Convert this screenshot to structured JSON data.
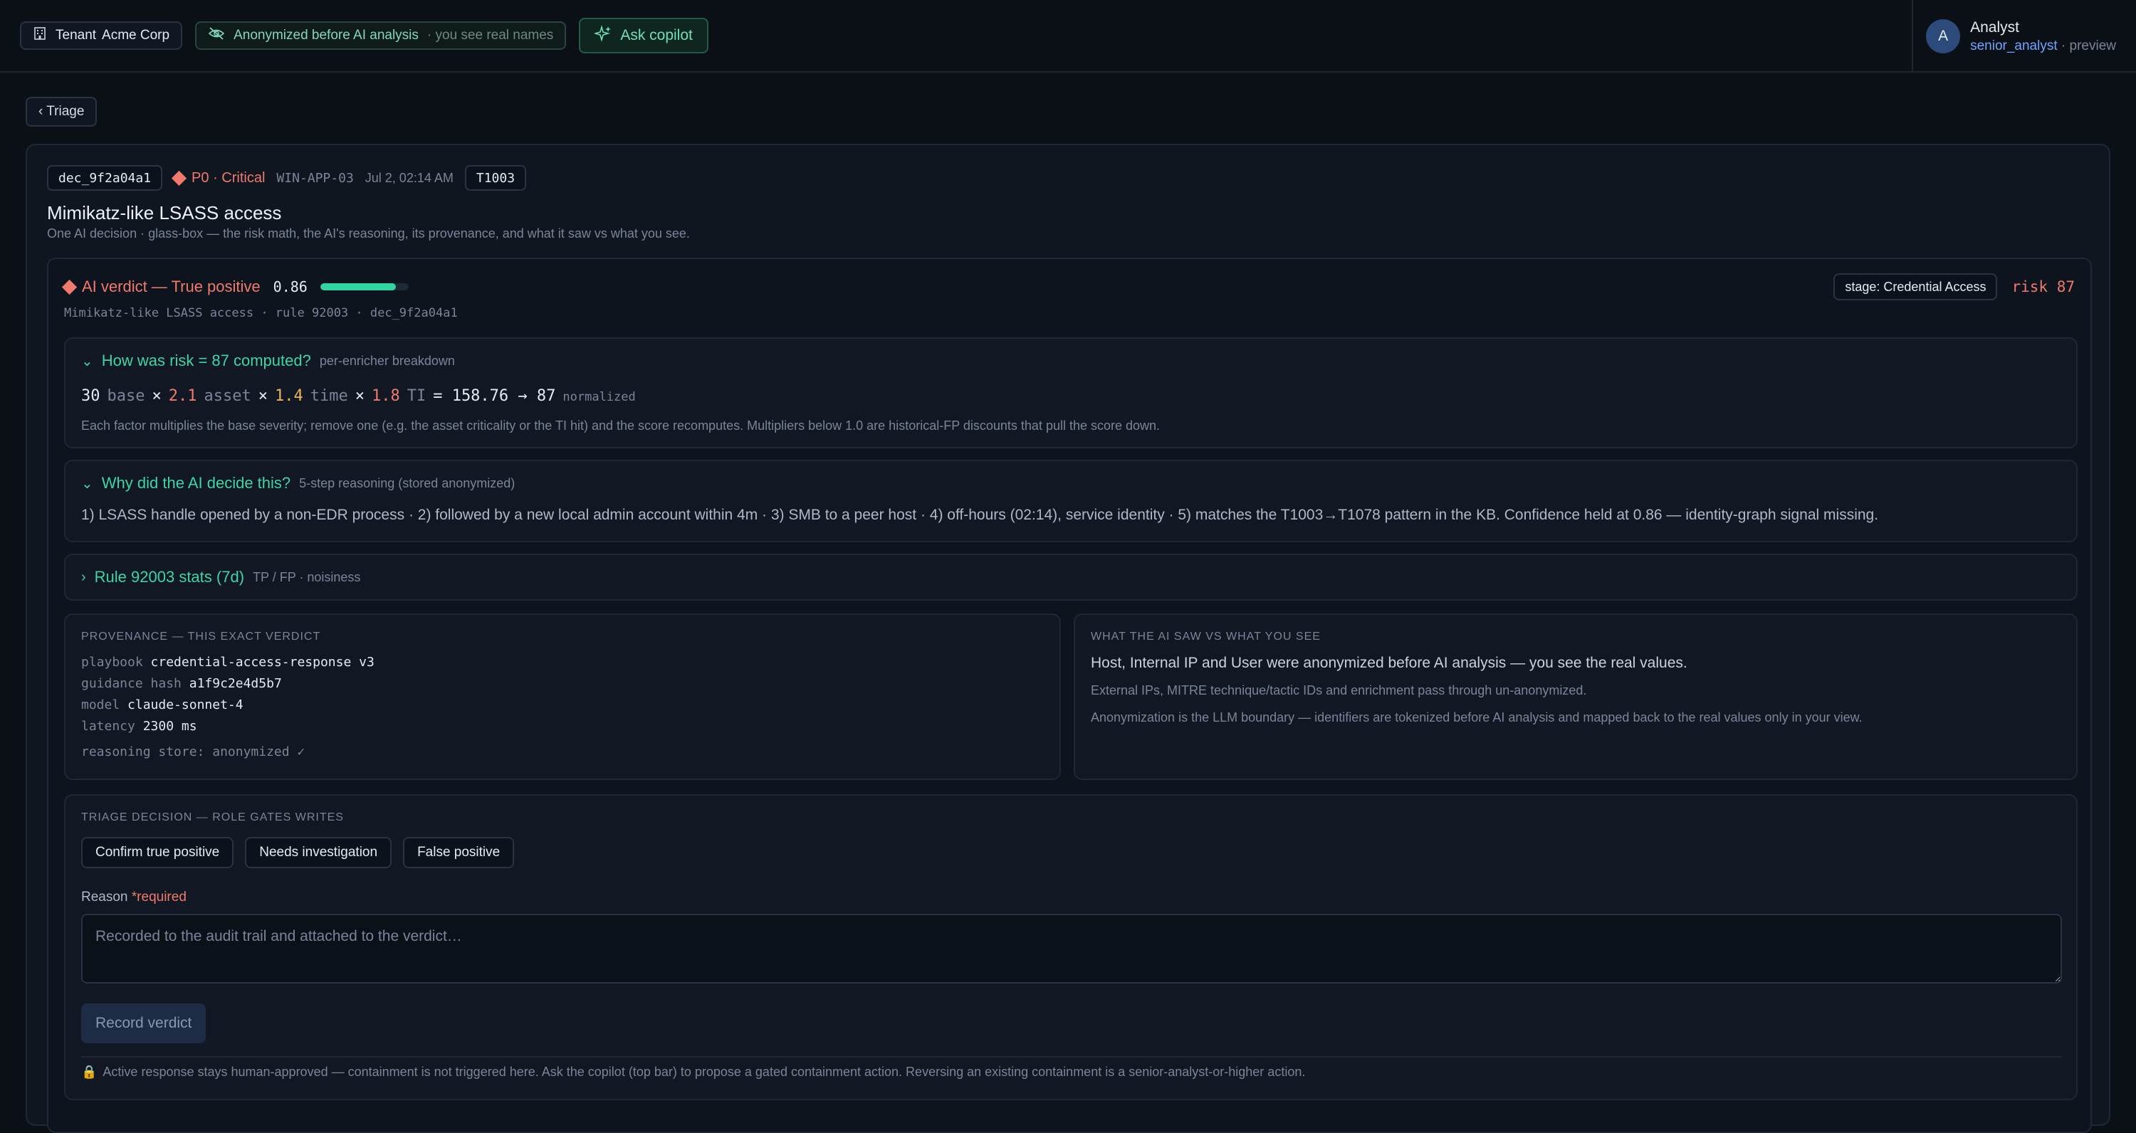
{
  "topbar": {
    "tenant_label": "Tenant",
    "tenant_name": "Acme Corp",
    "anon_label": "Anonymized before AI analysis",
    "anon_note": "· you see real names",
    "copilot_label": "Ask copilot"
  },
  "user": {
    "avatar_letter": "A",
    "name": "Analyst",
    "role": "senior_analyst",
    "mode": "· preview"
  },
  "nav": {
    "back_label": "‹ Triage"
  },
  "alert": {
    "id": "dec_9f2a04a1",
    "severity": "P0 · Critical",
    "host": "WIN-APP-03",
    "time": "Jul 2, 02:14 AM",
    "technique": "T1003",
    "title": "Mimikatz-like LSASS access",
    "subtitle": "One AI decision · glass-box — the risk math, the AI's reasoning, its provenance, and what it saw vs what you see."
  },
  "verdict": {
    "label": "AI verdict — True positive",
    "confidence": "0.86",
    "confidence_value": 0.86,
    "meta": "Mimikatz-like LSASS access · rule 92003 · dec_9f2a04a1",
    "stage": "stage: Credential Access",
    "risk": "risk 87"
  },
  "risk_breakdown": {
    "chevron": "⌄",
    "title": "How was risk = 87 computed?",
    "subtitle": "per-enricher breakdown",
    "base_val": "30",
    "base_lbl": "base",
    "times1": "×",
    "asset_val": "2.1",
    "asset_lbl": "asset",
    "times2": "×",
    "time_val": "1.4",
    "time_lbl": "time",
    "times3": "×",
    "ti_val": "1.8",
    "ti_lbl": "TI",
    "eq": "= 158.76 → 87",
    "norm": "normalized",
    "note": "Each factor multiplies the base severity; remove one (e.g. the asset criticality or the TI hit) and the score recomputes. Multipliers below 1.0 are historical-FP discounts that pull the score down."
  },
  "reasoning": {
    "chevron": "⌄",
    "title": "Why did the AI decide this?",
    "subtitle": "5-step reasoning (stored anonymized)",
    "text": "1) LSASS handle opened by a non-EDR process · 2) followed by a new local admin account within 4m · 3) SMB to a peer host · 4) off-hours (02:14), service identity · 5) matches the T1003→T1078 pattern in the KB. Confidence held at 0.86 — identity-graph signal missing."
  },
  "rule_stats": {
    "chevron": "›",
    "title": "Rule 92003 stats (7d)",
    "subtitle": "TP / FP · noisiness"
  },
  "provenance": {
    "caption": "PROVENANCE — THIS EXACT VERDICT",
    "playbook_k": "playbook",
    "playbook_v": "credential-access-response v3",
    "hash_k": "guidance hash",
    "hash_v": "a1f9c2e4d5b7",
    "model_k": "model",
    "model_v": "claude-sonnet-4",
    "latency_k": "latency",
    "latency_v": "2300 ms",
    "store": "reasoning store: anonymized ✓"
  },
  "saw": {
    "caption": "WHAT THE AI SAW VS WHAT YOU SEE",
    "main": "Host, Internal IP and User were anonymized before AI analysis — you see the real values.",
    "line1": "External IPs, MITRE technique/tactic IDs and enrichment pass through un-anonymized.",
    "line2": "Anonymization is the LLM boundary — identifiers are tokenized before AI analysis and mapped back to the real values only in your view."
  },
  "triage": {
    "caption": "TRIAGE DECISION — ROLE GATES WRITES",
    "btn_confirm": "Confirm true positive",
    "btn_investigate": "Needs investigation",
    "btn_fp": "False positive",
    "reason_label": "Reason",
    "reason_required": "*required",
    "reason_placeholder": "Recorded to the audit trail and attached to the verdict…",
    "record_label": "Record verdict",
    "lock": "🔒",
    "footer": "Active response stays human-approved — containment is not triggered here. Ask the copilot (top bar) to propose a gated containment action. Reversing an existing containment is a senior-analyst-or-higher action."
  },
  "colors": {
    "accent_green": "#3fd5a3",
    "critical_red": "#ef7a6d",
    "amber": "#f0b35a",
    "link_blue": "#6fa6ff",
    "background": "#0b0f16"
  },
  "icons": {
    "tenant": "building-icon",
    "anon": "eye-off-icon",
    "copilot": "sparkle-icon"
  }
}
